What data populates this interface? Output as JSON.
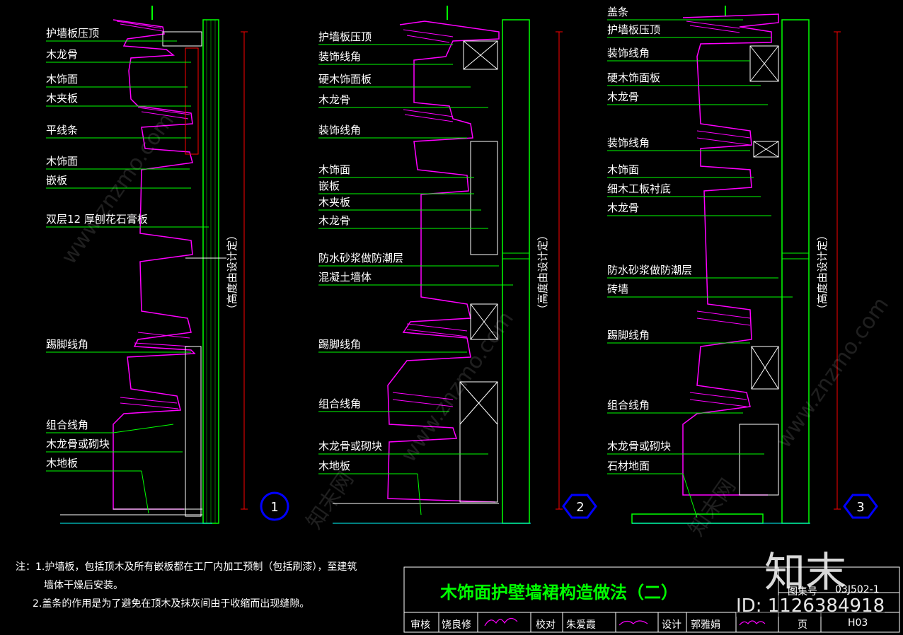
{
  "details": [
    {
      "number": "1",
      "height_note": "（高度由设计定）",
      "labels": [
        "护墙板压顶",
        "木龙骨",
        "木饰面",
        "木夹板",
        "平线条",
        "木饰面",
        "嵌板",
        "双层12 厚刨花石膏板",
        "踢脚线角",
        "组合线角",
        "木龙骨或砌块",
        "木地板"
      ]
    },
    {
      "number": "2",
      "height_note": "（高度由设计定）",
      "labels": [
        "护墙板压顶",
        "装饰线角",
        "硬木饰面板",
        "木龙骨",
        "装饰线角",
        "木饰面",
        "嵌板",
        "木夹板",
        "木龙骨",
        "防水砂浆做防潮层",
        "混凝土墙体",
        "踢脚线角",
        "组合线角",
        "木龙骨或砌块",
        "木地板"
      ]
    },
    {
      "number": "3",
      "height_note": "（高度由设计定）",
      "labels": [
        "盖条",
        "护墙板压顶",
        "装饰线角",
        "硬木饰面板",
        "木龙骨",
        "装饰线角",
        "木饰面",
        "细木工板衬底",
        "木龙骨",
        "防水砂浆做防潮层",
        "砖墙",
        "踢脚线角",
        "组合线角",
        "木龙骨或砌块",
        "石材地面"
      ]
    }
  ],
  "notes": [
    "注：1.护墙板，包括顶木及所有嵌板都在工厂内加工预制（包括刷漆），至建筑",
    "墙体干燥后安装。",
    "2.盖条的作用是为了避免在顶木及抹灰间由于收缩而出现缝隙。"
  ],
  "title_block": {
    "title": "木饰面护壁墙裙构造做法（二）",
    "atlas_label": "图集号",
    "atlas_no": "03J502-1",
    "review_label": "审核",
    "reviewer": "饶良修",
    "check_label": "校对",
    "checker": "朱爱霞",
    "design_label": "设计",
    "designer": "郭雅娟",
    "page_label": "页",
    "page_no": "H03"
  },
  "watermark": {
    "brand": "知末",
    "id_text": "ID: 1126384918",
    "site": "www.znzmo.com",
    "site_cn": "知末网"
  },
  "colors": {
    "background": "#000000",
    "leader": "#00ff00",
    "profile": "#ff00ff",
    "frame": "#ffffff",
    "dimension": "#ff0000",
    "marker": "#0000ff",
    "title": "#00ff00"
  }
}
